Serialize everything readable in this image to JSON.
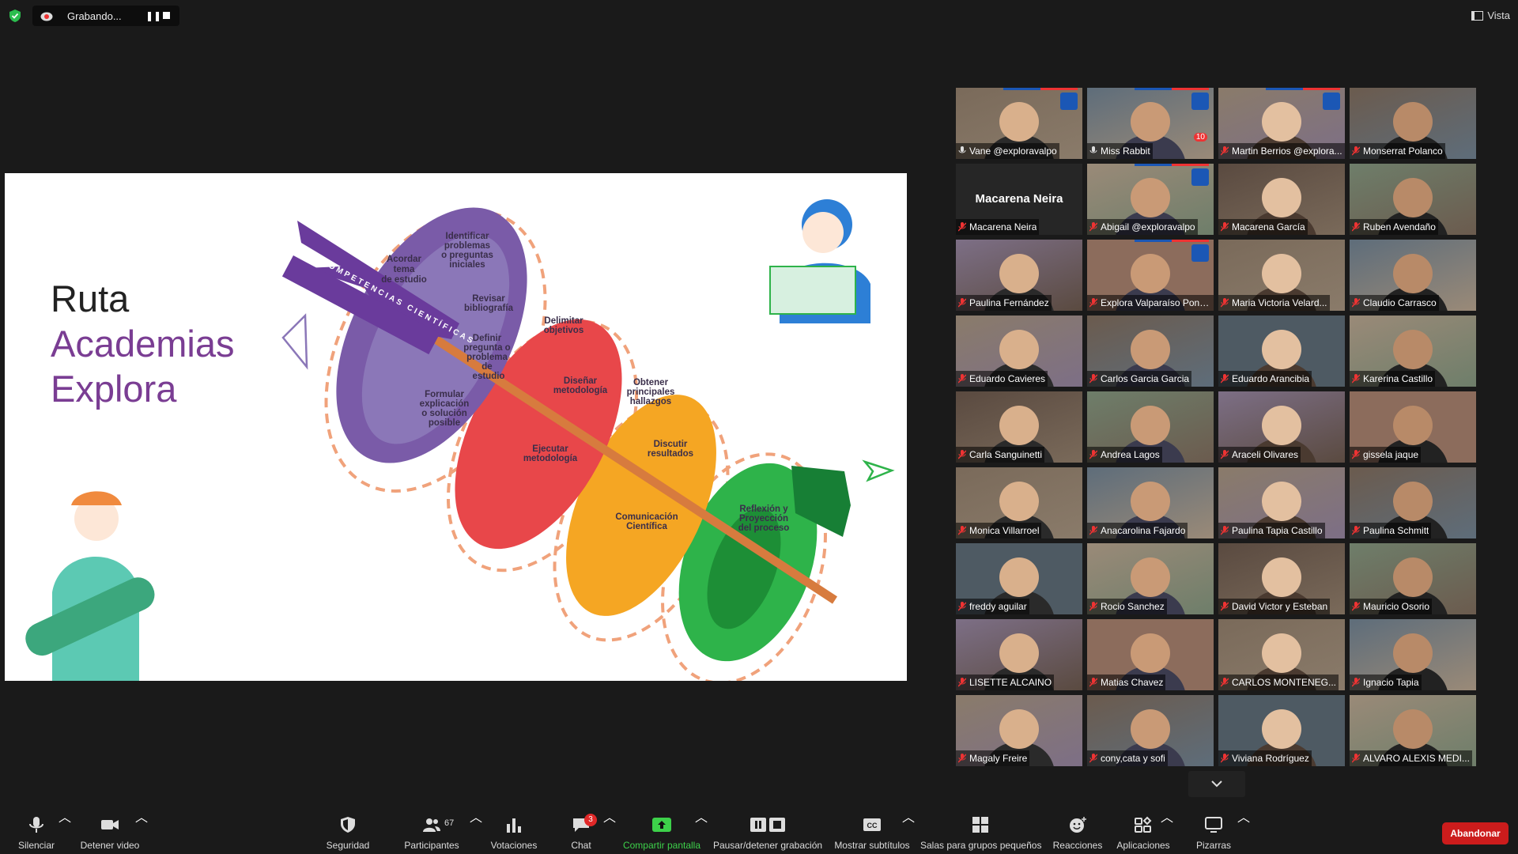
{
  "recording": {
    "status": "Grabando..."
  },
  "view_label": "Vista",
  "slide": {
    "title_l1": "Ruta",
    "title_l2": "Academias",
    "title_l3": "Explora",
    "band": "COMPETENCIAS CIENTÍFICAS",
    "steps": {
      "p1": "Acordar tema de estudio",
      "p2": "Identificar problemas o preguntas iniciales",
      "p3": "Revisar bibliografía",
      "p4": "Definir pregunta o problema de estudio",
      "p5": "Formular explicación o solución posible",
      "r1": "Delimitar objetivos",
      "r2": "Diseñar metodología",
      "r3": "Ejecutar metodología",
      "o1": "Obtener principales hallazgos",
      "o2": "Discutir resultados",
      "o3": "Comunicación Científica",
      "g1": "Reflexión y Proyección del proceso"
    }
  },
  "participants": [
    "Vane @exploravalpo",
    "Miss Rabbit",
    "Martin Berrios @explora...",
    "Monserrat Polanco",
    "Macarena Neira",
    "Abigail @exploravalpo",
    "Macarena García",
    "Ruben Avendaño",
    "Paulina Fernández",
    "Explora Valparaíso Ponti...",
    "Maria Victoria Velard...",
    "Claudio Carrasco",
    "Eduardo Cavieres",
    "Carlos Garcia Garcia",
    "Eduardo Arancibia",
    "Karerina Castillo",
    "Carla Sanguinetti",
    "Andrea Lagos",
    "Araceli Olivares",
    "gissela jaque",
    "Monica Villarroel",
    "Anacarolina Fajardo",
    "Paulina Tapia Castillo",
    "Paulina Schmitt",
    "freddy aguilar",
    "Rocio Sanchez",
    "David Victor y Esteban",
    "Mauricio Osorio",
    "LISETTE ALCAINO",
    "Matias Chavez",
    "CARLOS MONTENEG...",
    "Ignacio Tapia",
    "Magaly Freire",
    "cony,cata y sofi",
    "Viviana Rodríguez",
    "ALVARO ALEXIS MEDI..."
  ],
  "big_name": "Macarena Neira",
  "reaction_count": "10",
  "toolbar": {
    "mute": "Silenciar",
    "video": "Detener video",
    "security": "Seguridad",
    "participants": "Participantes",
    "participants_count": "67",
    "polls": "Votaciones",
    "chat": "Chat",
    "chat_badge": "3",
    "share": "Compartir pantalla",
    "pause_rec": "Pausar/detener grabación",
    "captions": "Mostrar subtítulos",
    "captions_icon": "CC",
    "breakout": "Salas para grupos pequeños",
    "reactions": "Reacciones",
    "apps": "Aplicaciones",
    "whiteboards": "Pizarras",
    "leave": "Abandonar"
  },
  "colors": {
    "purple": "#7a5ba8",
    "red": "#e8474a",
    "orange": "#f5a623",
    "green": "#2eb34a",
    "leave": "#cc1c1c",
    "active": "#cde85b"
  }
}
